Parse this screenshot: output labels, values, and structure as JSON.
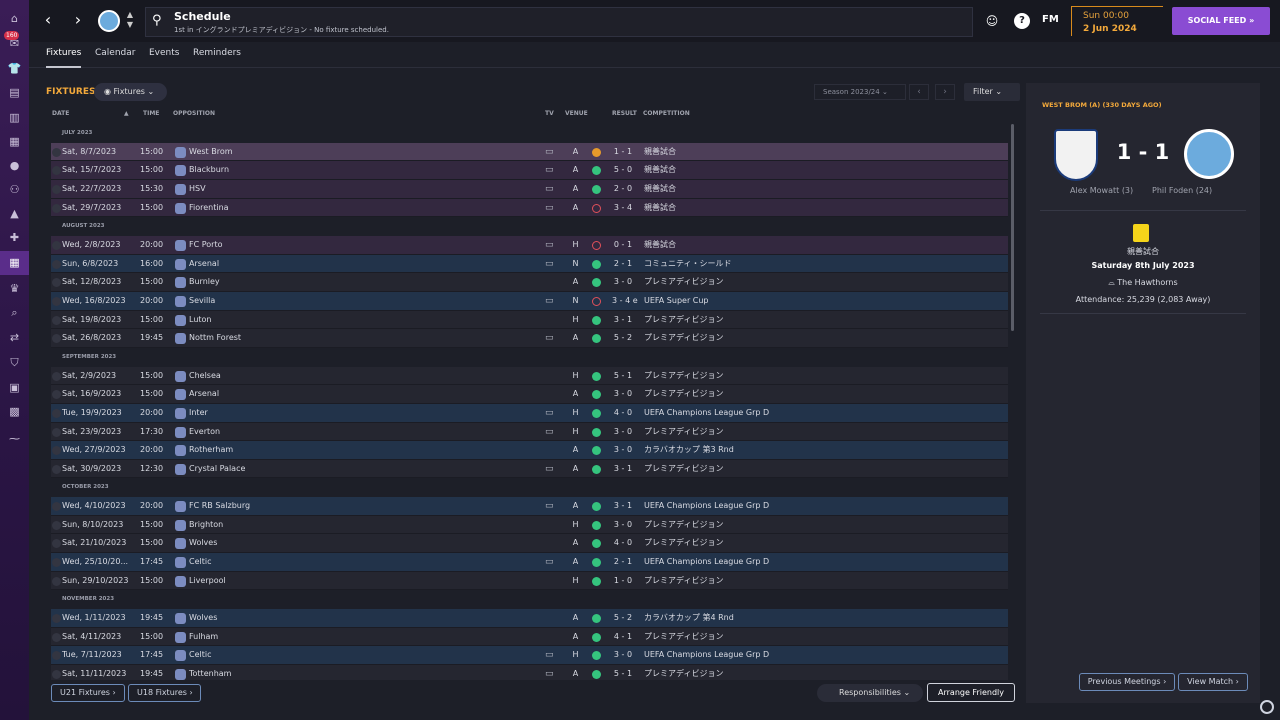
{
  "sidebar": {
    "badge": "160"
  },
  "header": {
    "title": "Schedule",
    "subtitle": "1st in イングランドプレミアディビジョン - No fixture scheduled.",
    "fm_logo": "FM",
    "time": "Sun 00:00",
    "date": "2 Jun 2024",
    "social_feed": "SOCIAL FEED"
  },
  "tabs": [
    {
      "label": "Fixtures",
      "active": true
    },
    {
      "label": "Calendar"
    },
    {
      "label": "Events"
    },
    {
      "label": "Reminders"
    }
  ],
  "toolbar": {
    "section_title": "FIXTURES",
    "view_dropdown": "Fixtures",
    "season": "Season 2023/24",
    "filter": "Filter"
  },
  "columns": {
    "date": "DATE",
    "time": "TIME",
    "opposition": "OPPOSITION",
    "tv": "TV",
    "venue": "VENUE",
    "result": "RESULT",
    "competition": "COMPETITION"
  },
  "groups": [
    {
      "month": "JULY 2023",
      "rows": [
        {
          "date": "Sat, 8/7/2023",
          "time": "15:00",
          "opp": "West Brom",
          "tv": true,
          "venue": "A",
          "res": "d",
          "score": "1 - 1",
          "comp": "親善試合",
          "style": "first"
        },
        {
          "date": "Sat, 15/7/2023",
          "time": "15:00",
          "opp": "Blackburn",
          "tv": true,
          "venue": "A",
          "res": "w",
          "score": "5 - 0",
          "comp": "親善試合",
          "style": "friendly"
        },
        {
          "date": "Sat, 22/7/2023",
          "time": "15:30",
          "opp": "HSV",
          "tv": true,
          "venue": "A",
          "res": "w",
          "score": "2 - 0",
          "comp": "親善試合",
          "style": "friendly"
        },
        {
          "date": "Sat, 29/7/2023",
          "time": "15:00",
          "opp": "Fiorentina",
          "tv": true,
          "venue": "A",
          "res": "l",
          "score": "3 - 4",
          "comp": "親善試合",
          "style": "friendly"
        }
      ]
    },
    {
      "month": "AUGUST 2023",
      "rows": [
        {
          "date": "Wed, 2/8/2023",
          "time": "20:00",
          "opp": "FC Porto",
          "tv": true,
          "venue": "H",
          "res": "l",
          "score": "0 - 1",
          "comp": "親善試合",
          "style": "friendly"
        },
        {
          "date": "Sun, 6/8/2023",
          "time": "16:00",
          "opp": "Arsenal",
          "tv": true,
          "venue": "N",
          "res": "w",
          "score": "2 - 1",
          "comp": "コミュニティ・シールド",
          "style": "ucl"
        },
        {
          "date": "Sat, 12/8/2023",
          "time": "15:00",
          "opp": "Burnley",
          "tv": false,
          "venue": "A",
          "res": "w",
          "score": "3 - 0",
          "comp": "プレミアディビジョン",
          "style": "plain"
        },
        {
          "date": "Wed, 16/8/2023",
          "time": "20:00",
          "opp": "Sevilla",
          "tv": true,
          "venue": "N",
          "res": "l",
          "score": "3 - 4 e",
          "comp": "UEFA Super Cup",
          "style": "ucl"
        },
        {
          "date": "Sat, 19/8/2023",
          "time": "15:00",
          "opp": "Luton",
          "tv": false,
          "venue": "H",
          "res": "w",
          "score": "3 - 1",
          "comp": "プレミアディビジョン",
          "style": "plain"
        },
        {
          "date": "Sat, 26/8/2023",
          "time": "19:45",
          "opp": "Nottm Forest",
          "tv": true,
          "venue": "A",
          "res": "w",
          "score": "5 - 2",
          "comp": "プレミアディビジョン",
          "style": "plain"
        }
      ]
    },
    {
      "month": "SEPTEMBER 2023",
      "rows": [
        {
          "date": "Sat, 2/9/2023",
          "time": "15:00",
          "opp": "Chelsea",
          "tv": false,
          "venue": "H",
          "res": "w",
          "score": "5 - 1",
          "comp": "プレミアディビジョン",
          "style": "plain"
        },
        {
          "date": "Sat, 16/9/2023",
          "time": "15:00",
          "opp": "Arsenal",
          "tv": false,
          "venue": "A",
          "res": "w",
          "score": "3 - 0",
          "comp": "プレミアディビジョン",
          "style": "plain"
        },
        {
          "date": "Tue, 19/9/2023",
          "time": "20:00",
          "opp": "Inter",
          "tv": true,
          "venue": "H",
          "res": "w",
          "score": "4 - 0",
          "comp": "UEFA Champions League Grp D",
          "style": "ucl"
        },
        {
          "date": "Sat, 23/9/2023",
          "time": "17:30",
          "opp": "Everton",
          "tv": true,
          "venue": "H",
          "res": "w",
          "score": "3 - 0",
          "comp": "プレミアディビジョン",
          "style": "plain"
        },
        {
          "date": "Wed, 27/9/2023",
          "time": "20:00",
          "opp": "Rotherham",
          "tv": false,
          "venue": "A",
          "res": "w",
          "score": "3 - 0",
          "comp": "カラバオカップ 第3 Rnd",
          "style": "ucl"
        },
        {
          "date": "Sat, 30/9/2023",
          "time": "12:30",
          "opp": "Crystal Palace",
          "tv": true,
          "venue": "A",
          "res": "w",
          "score": "3 - 1",
          "comp": "プレミアディビジョン",
          "style": "plain"
        }
      ]
    },
    {
      "month": "OCTOBER 2023",
      "rows": [
        {
          "date": "Wed, 4/10/2023",
          "time": "20:00",
          "opp": "FC RB Salzburg",
          "tv": true,
          "venue": "A",
          "res": "w",
          "score": "3 - 1",
          "comp": "UEFA Champions League Grp D",
          "style": "ucl"
        },
        {
          "date": "Sun, 8/10/2023",
          "time": "15:00",
          "opp": "Brighton",
          "tv": false,
          "venue": "H",
          "res": "w",
          "score": "3 - 0",
          "comp": "プレミアディビジョン",
          "style": "plain"
        },
        {
          "date": "Sat, 21/10/2023",
          "time": "15:00",
          "opp": "Wolves",
          "tv": false,
          "venue": "A",
          "res": "w",
          "score": "4 - 0",
          "comp": "プレミアディビジョン",
          "style": "plain"
        },
        {
          "date": "Wed, 25/10/20...",
          "time": "17:45",
          "opp": "Celtic",
          "tv": true,
          "venue": "A",
          "res": "w",
          "score": "2 - 1",
          "comp": "UEFA Champions League Grp D",
          "style": "ucl"
        },
        {
          "date": "Sun, 29/10/2023",
          "time": "15:00",
          "opp": "Liverpool",
          "tv": false,
          "venue": "H",
          "res": "w",
          "score": "1 - 0",
          "comp": "プレミアディビジョン",
          "style": "plain"
        }
      ]
    },
    {
      "month": "NOVEMBER 2023",
      "rows": [
        {
          "date": "Wed, 1/11/2023",
          "time": "19:45",
          "opp": "Wolves",
          "tv": false,
          "venue": "A",
          "res": "w",
          "score": "5 - 2",
          "comp": "カラバオカップ 第4 Rnd",
          "style": "ucl"
        },
        {
          "date": "Sat, 4/11/2023",
          "time": "15:00",
          "opp": "Fulham",
          "tv": false,
          "venue": "A",
          "res": "w",
          "score": "4 - 1",
          "comp": "プレミアディビジョン",
          "style": "plain"
        },
        {
          "date": "Tue, 7/11/2023",
          "time": "17:45",
          "opp": "Celtic",
          "tv": true,
          "venue": "H",
          "res": "w",
          "score": "3 - 0",
          "comp": "UEFA Champions League Grp D",
          "style": "ucl"
        },
        {
          "date": "Sat, 11/11/2023",
          "time": "19:45",
          "opp": "Tottenham",
          "tv": true,
          "venue": "A",
          "res": "w",
          "score": "5 - 1",
          "comp": "プレミアディビジョン",
          "style": "plain"
        }
      ]
    }
  ],
  "bottom": {
    "u21": "U21 Fixtures",
    "u18": "U18 Fixtures",
    "responsibilities": "Responsibilities",
    "arrange_friendly": "Arrange Friendly"
  },
  "panel": {
    "title": "WEST BROM (A) (330 DAYS AGO)",
    "score": "1 - 1",
    "home_scorer": "Alex Mowatt (3)",
    "away_scorer": "Phil Foden (24)",
    "competition": "親善試合",
    "match_date": "Saturday 8th July 2023",
    "stadium": "The Hawthorns",
    "attendance": "Attendance: 25,239 (2,083 Away)",
    "prev_meetings": "Previous Meetings",
    "view_match": "View Match"
  },
  "colors": {
    "accent": "#f3a93b",
    "win": "#35c47e",
    "draw": "#e59a2b",
    "loss": "#e0505a",
    "social": "#8a4cd3"
  }
}
